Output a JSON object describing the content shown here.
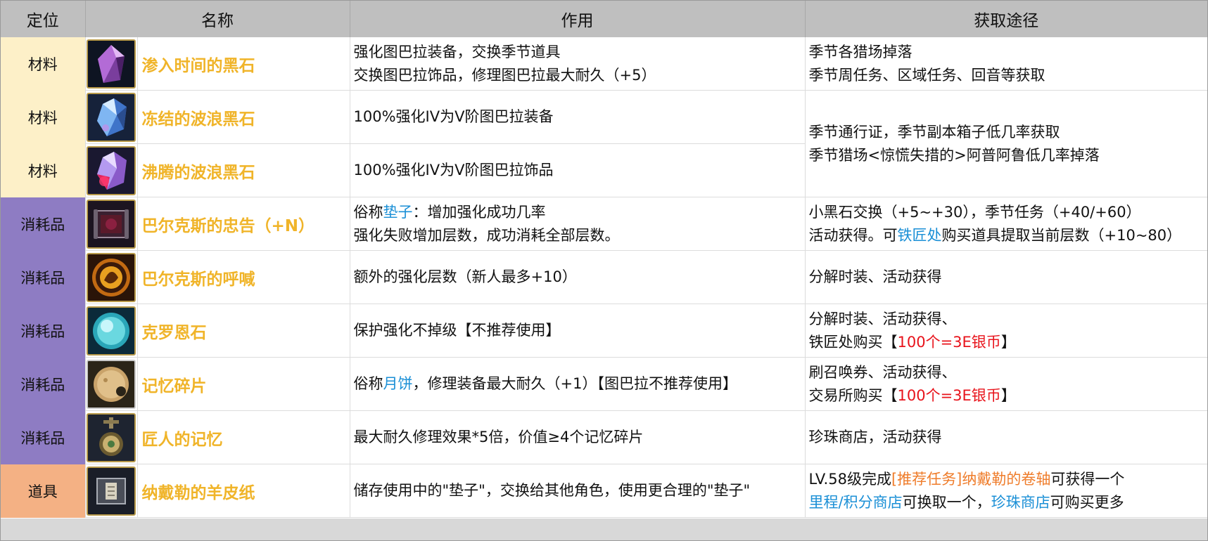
{
  "header": {
    "col_type": "定位",
    "col_name": "名称",
    "col_effect": "作用",
    "col_source": "获取途径"
  },
  "rows": [
    {
      "type": "材料",
      "icon": "purple-crystal-icon",
      "name": "渗入时间的黑石",
      "effect_line1": "强化图巴拉装备，交换季节道具",
      "effect_line2": "交换图巴拉饰品，修理图巴拉最大耐久（+5）",
      "source_line1": "季节各猎场掉落",
      "source_line2": "季节周任务、区域任务、回音等获取"
    },
    {
      "type": "材料",
      "icon": "blue-wave-crystal-icon",
      "name": "冻结的波浪黑石",
      "effect_line1": "100%强化IV为Ⅴ阶图巴拉装备"
    },
    {
      "type": "材料",
      "icon": "red-wave-crystal-icon",
      "name": "沸腾的波浪黑石",
      "effect_line1": "100%强化IV为Ⅴ阶图巴拉饰品"
    },
    {
      "type": "消耗品",
      "icon": "scroll-advice-icon",
      "name": "巴尔克斯的忠告",
      "name_suffix": "（+N）",
      "effect_prefix": "俗称",
      "effect_highlight": "垫子",
      "effect_suffix": "：增加强化成功几率",
      "effect_line2": "强化失败增加层数，成功消耗全部层数。",
      "source_line1": "小黑石交换（+5~+30），季节任务（+40/+60）",
      "source_line2_prefix": "活动获得。可",
      "source_line2_highlight": "铁匠处",
      "source_line2_suffix": "购买道具提取当前层数（+10~80）"
    },
    {
      "type": "消耗品",
      "icon": "fire-orb-icon",
      "name": "巴尔克斯的呼喊",
      "effect_line1": "额外的强化层数（新人最多+10）",
      "source_line1": "分解时装、活动获得"
    },
    {
      "type": "消耗品",
      "icon": "cyan-orb-icon",
      "name": "克罗恩石",
      "effect_line1": "保护强化不掉级【不推荐使用】",
      "source_line1": "分解时装、活动获得、",
      "source_line2_prefix": "铁匠处购买【",
      "source_line2_highlight": "100个=3E银币",
      "source_line2_suffix": "】"
    },
    {
      "type": "消耗品",
      "icon": "moon-cake-icon",
      "name": "记忆碎片",
      "effect_prefix": "俗称",
      "effect_highlight": "月饼",
      "effect_suffix": "，修理装备最大耐久（+1）【图巴拉不推荐使用】",
      "source_line1": "刷召唤券、活动获得、",
      "source_line2_prefix": "交易所购买【",
      "source_line2_highlight": "100个=3E银币",
      "source_line2_suffix": "】"
    },
    {
      "type": "消耗品",
      "icon": "pendant-icon",
      "name": "匠人的记忆",
      "effect_line1": "最大耐久修理效果*5倍，价值≥4个记忆碎片",
      "source_line1": "珍珠商店，活动获得"
    },
    {
      "type": "道具",
      "icon": "parchment-icon",
      "name": "纳戴勒的羊皮纸",
      "effect_line1": "储存使用中的\"垫子\"，交换给其他角色，使用更合理的\"垫子\"",
      "source_line1_prefix": "LV.58级完成",
      "source_line1_highlight": "[推荐任务]纳戴勒的卷轴",
      "source_line1_suffix": "可获得一个",
      "source_line2_a": "里程/积分商店",
      "source_line2_b": "可换取一个，",
      "source_line2_c": "珍珠商店",
      "source_line2_d": "可购买更多"
    }
  ],
  "shared_source": {
    "line1": "季节通行证，季节副本箱子低几率获取",
    "line2": "季节猎场<惊慌失措的>阿普阿鲁低几率掉落"
  },
  "colors": {
    "header_bg": "#bfbfbf",
    "material_bg": "#fdf0c8",
    "consumable_bg": "#8e7cc3",
    "prop_bg": "#f4b184",
    "name_gold": "#f0b429",
    "link_blue": "#1a8fd6",
    "price_red": "#e8131b",
    "quest_orange": "#ef7c2a"
  }
}
